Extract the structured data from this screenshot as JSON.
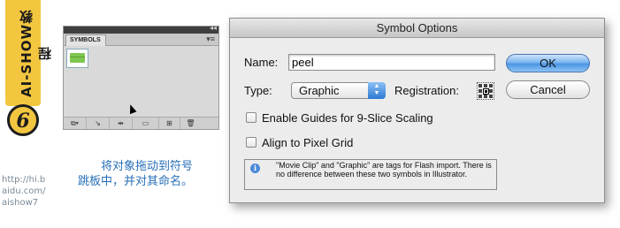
{
  "banner": {
    "vertical_text": "AI-SHOW教程",
    "step_number": "6"
  },
  "url_lines": [
    "http://hi.b",
    "aidu.com/",
    "aishow7"
  ],
  "caption_lines": [
    "将对象拖动到符号",
    "跳板中，并对其命名。"
  ],
  "symbols_panel": {
    "tab_label": "SYMBOLS",
    "collapse_glyph": "◂◂",
    "menu_glyph": "▾≡",
    "toolbar_icons": [
      "symbol-libraries-icon",
      "place-instance-icon",
      "break-link-icon",
      "symbol-options-icon",
      "new-symbol-icon",
      "delete-symbol-icon"
    ]
  },
  "dialog": {
    "title": "Symbol Options",
    "name_label": "Name:",
    "name_value": "peel",
    "type_label": "Type:",
    "type_value": "Graphic",
    "registration_label": "Registration:",
    "registration_selected": "center",
    "ok_label": "OK",
    "cancel_label": "Cancel",
    "guides_label": "Enable Guides for 9-Slice Scaling",
    "guides_checked": false,
    "pixel_grid_label": "Align to Pixel Grid",
    "pixel_grid_checked": false,
    "info_text": "\"Movie Clip\" and \"Graphic\" are tags for Flash import. There is no difference between these two symbols in Illustrator."
  },
  "colors": {
    "banner_yellow": "#f3c640",
    "caption_blue": "#2870b8",
    "ok_blue": "#4b95e4"
  }
}
